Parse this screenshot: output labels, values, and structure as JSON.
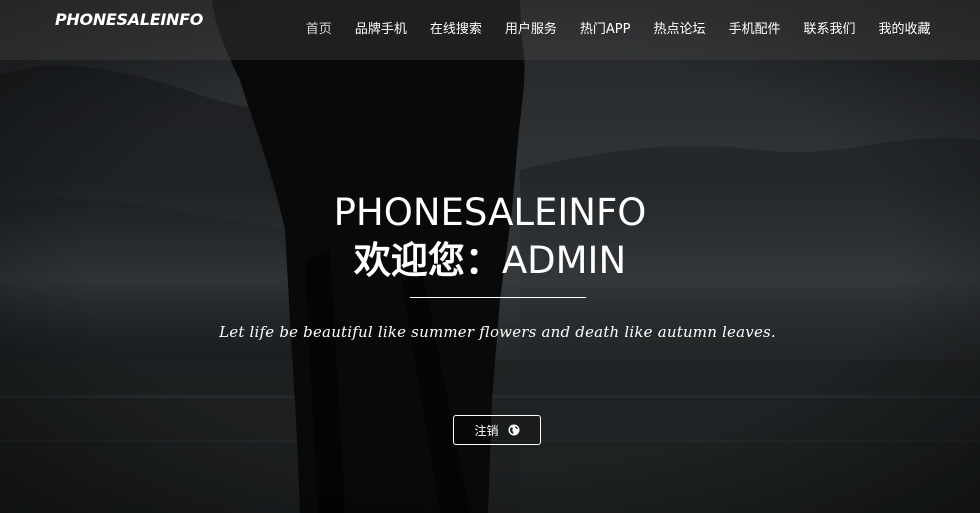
{
  "brand": "PHONESALEINFO",
  "nav": {
    "items": [
      {
        "label": "首页"
      },
      {
        "label": "品牌手机"
      },
      {
        "label": "在线搜索"
      },
      {
        "label": "用户服务"
      },
      {
        "label": "热门APP"
      },
      {
        "label": "热点论坛"
      },
      {
        "label": "手机配件"
      },
      {
        "label": "联系我们"
      },
      {
        "label": "我的收藏"
      }
    ]
  },
  "hero": {
    "title_line1": "PHONESALEINFO",
    "title_line2_cn": "欢迎您：",
    "title_line2_user": "ADMIN",
    "quote": "Let life be beautiful like summer flowers and death like autumn leaves.",
    "logout_label": "注销",
    "logout_icon": "globe-icon"
  },
  "colors": {
    "nav_bar": "#464646",
    "text": "#ffffff"
  }
}
